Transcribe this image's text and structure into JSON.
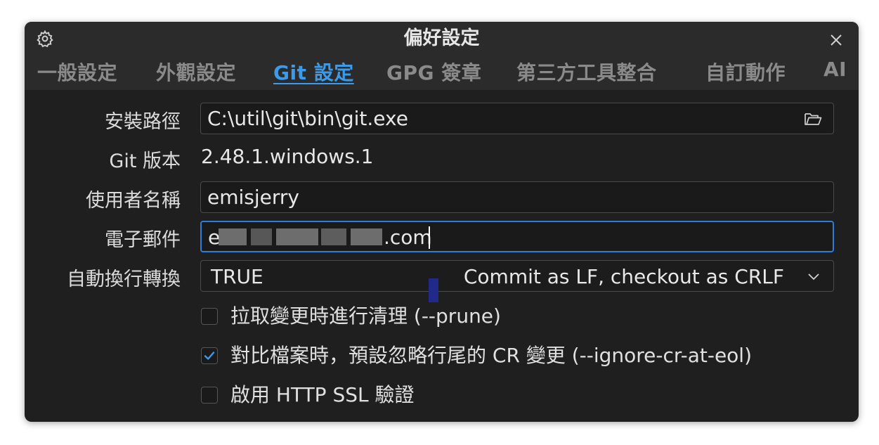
{
  "window": {
    "title": "偏好設定"
  },
  "tabs": [
    {
      "label": "一般設定",
      "active": false
    },
    {
      "label": "外觀設定",
      "active": false
    },
    {
      "label": "Git 設定",
      "active": true
    },
    {
      "label": "GPG 簽章",
      "active": false
    },
    {
      "label": "第三方工具整合",
      "active": false
    },
    {
      "label": "自訂動作",
      "active": false
    },
    {
      "label": "AI",
      "active": false
    }
  ],
  "form": {
    "install_path": {
      "label": "安裝路徑",
      "value": "C:\\util\\git\\bin\\git.exe"
    },
    "git_version": {
      "label": "Git 版本",
      "value": "2.48.1.windows.1"
    },
    "user_name": {
      "label": "使用者名稱",
      "value": "emisjerry"
    },
    "email": {
      "label": "電子郵件",
      "value_prefix": "e",
      "value_suffix": ".com"
    },
    "autocrlf": {
      "label": "自動換行轉換",
      "value": "TRUE",
      "description": "Commit as LF, checkout as CRLF"
    }
  },
  "options": [
    {
      "label": "拉取變更時進行清理 (--prune)",
      "checked": false
    },
    {
      "label": "對比檔案時，預設忽略行尾的 CR 變更 (--ignore-cr-at-eol)",
      "checked": true
    },
    {
      "label": "啟用 HTTP SSL 驗證",
      "checked": false
    }
  ],
  "colors": {
    "accent": "#3b9bea",
    "focus_border": "#2b7fd6",
    "background": "#1f1f1f"
  }
}
